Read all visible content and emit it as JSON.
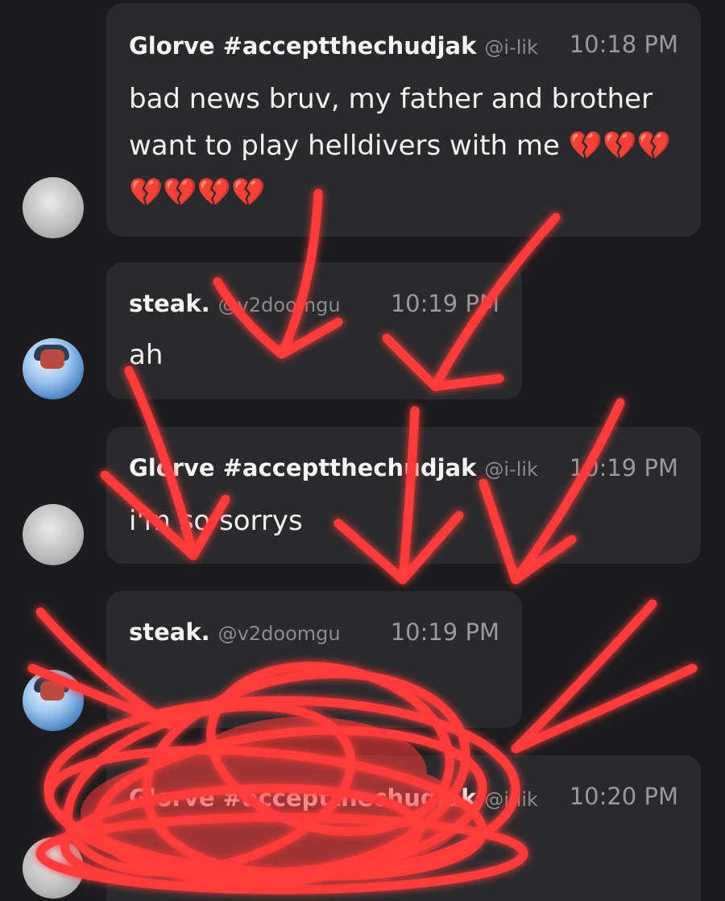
{
  "colors": {
    "background": "#1c1c1e",
    "bubble": "#2a2a2c",
    "scribble": "#ff3b3b"
  },
  "messages": [
    {
      "author": "Glorve #acceptthechudjak",
      "handle": "@i-lik",
      "time": "10:18 PM",
      "text": "bad news bruv, my father and brother want to play helldivers with me 💔💔💔💔💔💔💔",
      "avatar": "gray-blob"
    },
    {
      "author": "steak.",
      "handle": "@v2doomgu",
      "time": "10:19 PM",
      "text": "ah",
      "avatar": "anime-character"
    },
    {
      "author": "Glorve #acceptthechudjak",
      "handle": "@i-lik",
      "time": "10:19 PM",
      "text": "i'm so sorrys",
      "avatar": "gray-blob"
    },
    {
      "author": "steak.",
      "handle": "@v2doomgu",
      "time": "10:19 PM",
      "text": "",
      "avatar": "anime-character"
    },
    {
      "author": "Glorve #acceptthechudjak",
      "handle": "@i-lik",
      "time": "10:20 PM",
      "text": "",
      "avatar": "gray-blob"
    }
  ]
}
